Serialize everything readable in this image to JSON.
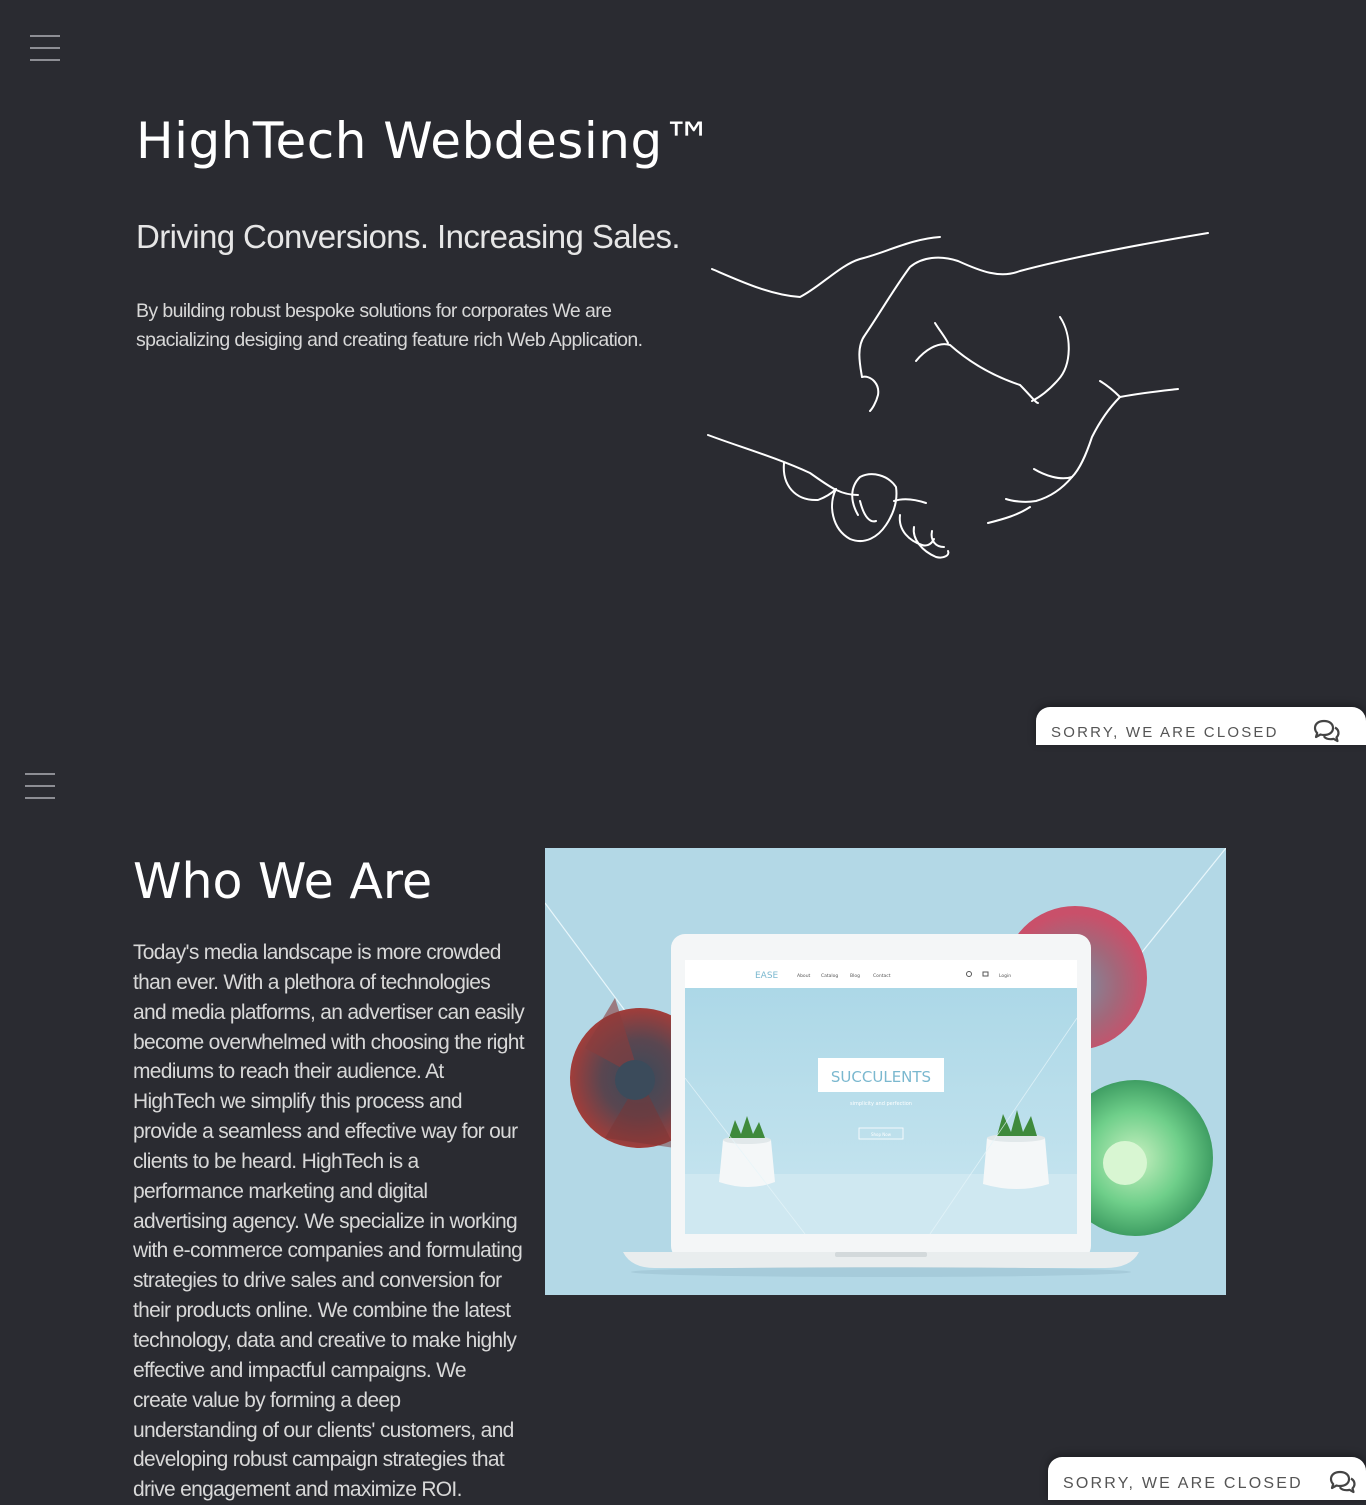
{
  "hero": {
    "title": "HighTech Webdesing™",
    "tagline": "Driving Conversions. Increasing Sales.",
    "description": "By building robust bespoke solutions for corporates We are spacializing desiging and creating feature rich Web Application."
  },
  "about": {
    "title": "Who We Are",
    "body": "Today's media landscape is more crowded than ever. With a plethora of technologies and media platforms, an advertiser can easily become overwhelmed with choosing the right mediums to reach their audience. At HighTech we simplify this process and provide a seamless and effective way for our clients to be heard. HighTech is a performance marketing and digital advertising agency. We specialize in working with e-commerce companies and formulating strategies to drive sales and conversion for their products online. We combine the latest technology, data and creative to make highly effective and impactful campaigns. We create value by forming a deep understanding of our clients' customers, and developing robust campaign strategies that drive engagement and maximize ROI."
  },
  "chat": {
    "status_label": "SORRY, WE ARE CLOSED"
  },
  "mockup": {
    "brand": "EASE",
    "nav": [
      "About",
      "Catalog",
      "Blog",
      "Contact"
    ],
    "login": "Login",
    "headline": "SUCCULENTS",
    "subline": "simplicity and perfection",
    "button": "Shop Now"
  },
  "colors": {
    "background": "#2a2b31",
    "text": "#ffffff",
    "chat_background": "#ffffff",
    "showcase_background": "#b3d8e6"
  }
}
